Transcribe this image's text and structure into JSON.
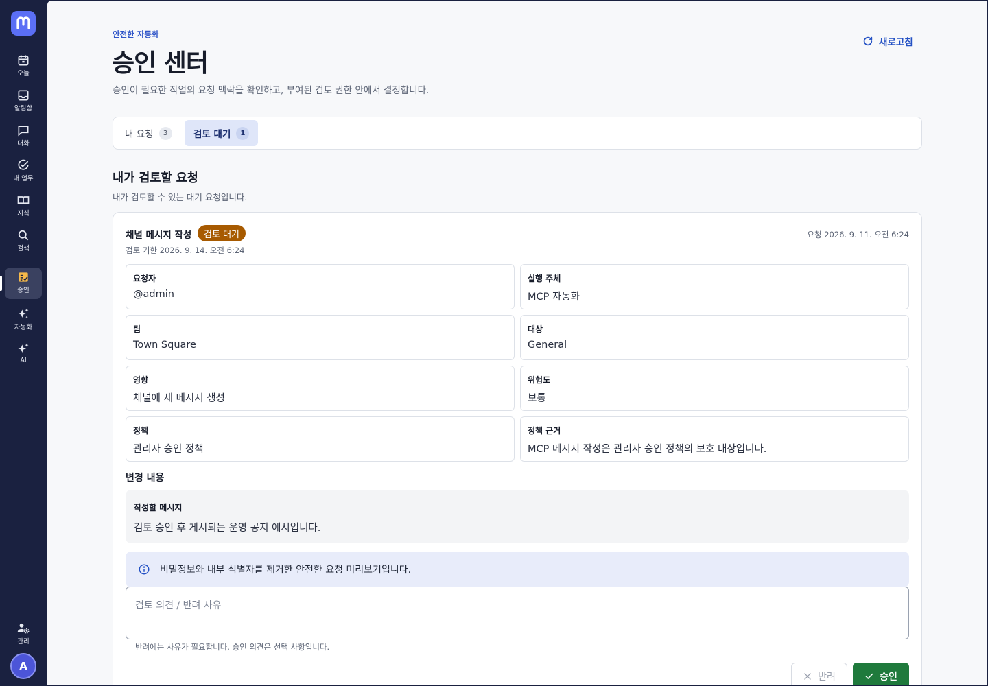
{
  "sidebar": {
    "logo": "m-logo",
    "items": [
      {
        "label": "오늘",
        "icon": "calendar-icon"
      },
      {
        "label": "알림함",
        "icon": "inbox-icon"
      },
      {
        "label": "대화",
        "icon": "chat-icon"
      },
      {
        "label": "내 업무",
        "icon": "check-circle-icon"
      },
      {
        "label": "지식",
        "icon": "book-icon"
      },
      {
        "label": "검색",
        "icon": "search-icon"
      },
      {
        "label": "승인",
        "icon": "approval-icon",
        "active": true
      },
      {
        "label": "자동화",
        "icon": "sparkles-icon"
      },
      {
        "label": "AI",
        "icon": "ai-sparkle-icon"
      }
    ],
    "admin": {
      "label": "관리",
      "icon": "admin-gear-icon"
    },
    "avatar": "A"
  },
  "header": {
    "eyebrow": "안전한 자동화",
    "title": "승인 센터",
    "description": "승인이 필요한 작업의 요청 맥락을 확인하고, 부여된 검토 권한 안에서 결정합니다.",
    "refresh_label": "새로고침"
  },
  "tabs": [
    {
      "label": "내 요청",
      "count": "3"
    },
    {
      "label": "검토 대기",
      "count": "1",
      "active": true
    }
  ],
  "section": {
    "title": "내가 검토할 요청",
    "description": "내가 검토할 수 있는 대기 요청입니다."
  },
  "request": {
    "title": "채널 메시지 작성",
    "status": "검토 대기",
    "deadline": "검토 기한 2026. 9. 14. 오전 6:24",
    "requested": "요청 2026. 9. 11. 오전 6:24",
    "fields": [
      {
        "label": "요청자",
        "value": "@admin"
      },
      {
        "label": "실행 주체",
        "value": "MCP 자동화"
      },
      {
        "label": "팀",
        "value": "Town Square"
      },
      {
        "label": "대상",
        "value": "General"
      },
      {
        "label": "영향",
        "value": "채널에 새 메시지 생성"
      },
      {
        "label": "위험도",
        "value": "보통"
      },
      {
        "label": "정책",
        "value": "관리자 승인 정책"
      },
      {
        "label": "정책 근거",
        "value": "MCP 메시지 작성은 관리자 승인 정책의 보호 대상입니다."
      }
    ],
    "changes_title": "변경 내용",
    "change_label": "작성할 메시지",
    "change_value": "검토 승인 후 게시되는 운영 공지 예시입니다.",
    "info": "비밀정보와 내부 식별자를 제거한 안전한 요청 미리보기입니다.",
    "comment_placeholder": "검토 의견 / 반려 사유",
    "hint": "반려에는 사유가 필요합니다. 승인 의견은 선택 사항입니다.",
    "reject_label": "반려",
    "approve_label": "승인"
  },
  "colors": {
    "sidebar_bg": "#1a2140",
    "accent": "#2451c4",
    "status_badge": "#a75a00",
    "approve": "#1f7a3c"
  }
}
